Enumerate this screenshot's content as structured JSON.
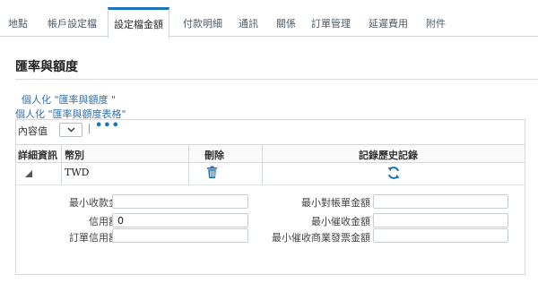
{
  "tabs": [
    {
      "label": "地點"
    },
    {
      "label": "帳戶設定檔"
    },
    {
      "label": "設定檔金額",
      "active": true
    },
    {
      "label": "付款明細"
    },
    {
      "label": "通訊"
    },
    {
      "label": "關係"
    },
    {
      "label": "訂單管理"
    },
    {
      "label": "延遲費用"
    },
    {
      "label": "附件"
    }
  ],
  "section": {
    "title": "匯率與額度",
    "personalize_1": "個人化 \"匯率與額度 \"",
    "personalize_2": "個人化 \"匯率與額度表格\""
  },
  "table": {
    "view_label": "內容值",
    "columns": [
      "詳細資訊",
      "幣別",
      "刪除",
      "記錄歷史記錄"
    ],
    "rows": [
      {
        "currency": "TWD"
      }
    ]
  },
  "detail_fields": {
    "left": [
      {
        "label": "最小收款金額",
        "value": ""
      },
      {
        "label": "信用額度",
        "value": "0"
      },
      {
        "label": "訂單信用額度",
        "value": ""
      }
    ],
    "right": [
      {
        "label": "最小對帳單金額",
        "value": ""
      },
      {
        "label": "最小催收金額",
        "value": ""
      },
      {
        "label": "最小催收商業發票金額",
        "value": ""
      }
    ]
  },
  "colors": {
    "accent": "#1b75bc",
    "link": "#2f6fae"
  },
  "icons": {
    "delete": "trash-icon",
    "history": "refresh-icon",
    "expand": "collapse-triangle-icon",
    "more": "more-dots-icon",
    "dropdown": "chevron-down-icon"
  }
}
